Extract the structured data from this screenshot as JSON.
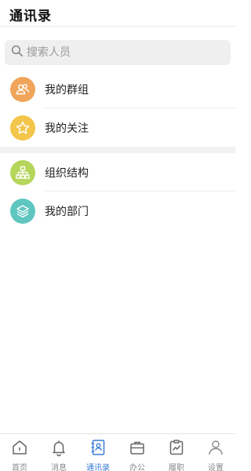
{
  "header": {
    "title": "通讯录"
  },
  "search": {
    "placeholder": "搜索人员",
    "value": ""
  },
  "group1": [
    {
      "label": "我的群组",
      "icon": "people-icon",
      "color": "#f0a55a"
    },
    {
      "label": "我的关注",
      "icon": "star-icon",
      "color": "#f3c54a"
    }
  ],
  "group2": [
    {
      "label": "组织结构",
      "icon": "org-chart-icon",
      "color": "#b5d65a"
    },
    {
      "label": "我的部门",
      "icon": "layers-icon",
      "color": "#5fc6c0"
    }
  ],
  "tabs": [
    {
      "label": "首页",
      "icon": "home-icon",
      "active": false
    },
    {
      "label": "消息",
      "icon": "bell-icon",
      "active": false
    },
    {
      "label": "通讯录",
      "icon": "contacts-icon",
      "active": true
    },
    {
      "label": "办公",
      "icon": "briefcase-icon",
      "active": false
    },
    {
      "label": "履职",
      "icon": "clipboard-chart-icon",
      "active": false
    },
    {
      "label": "设置",
      "icon": "user-icon",
      "active": false
    }
  ],
  "colors": {
    "accent": "#3a7bd5",
    "inactive": "#888888"
  }
}
